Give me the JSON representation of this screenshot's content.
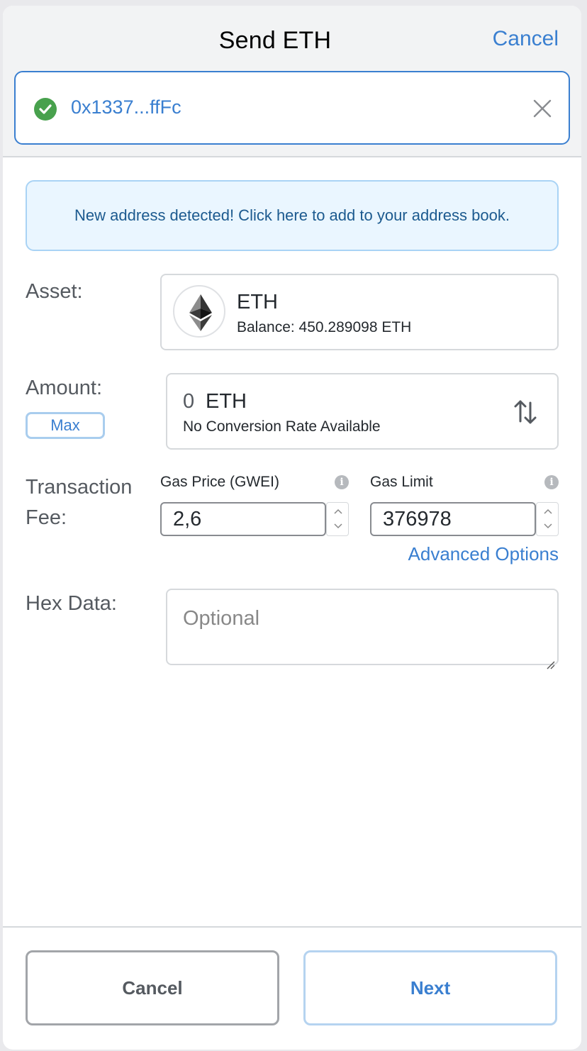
{
  "header": {
    "title": "Send ETH",
    "cancel_label": "Cancel",
    "recipient_address": "0x1337...ffFc"
  },
  "notice": {
    "text": "New address detected! Click here to add to your address book."
  },
  "asset": {
    "label": "Asset:",
    "name": "ETH",
    "balance": "Balance: 450.289098 ETH",
    "icon": "ethereum-icon"
  },
  "amount": {
    "label": "Amount:",
    "max_label": "Max",
    "value": "0",
    "unit": "ETH",
    "conversion": "No Conversion Rate Available"
  },
  "fee": {
    "label_line1": "Transaction",
    "label_line2": "Fee:",
    "gas_price_label": "Gas Price (GWEI)",
    "gas_price_value": "2,6",
    "gas_limit_label": "Gas Limit",
    "gas_limit_value": "376978",
    "advanced_label": "Advanced Options"
  },
  "hex": {
    "label": "Hex Data:",
    "placeholder": "Optional"
  },
  "footer": {
    "cancel_label": "Cancel",
    "next_label": "Next"
  },
  "colors": {
    "accent": "#3a7fd0",
    "success": "#48a14d",
    "notice_bg": "#eaf6ff"
  }
}
